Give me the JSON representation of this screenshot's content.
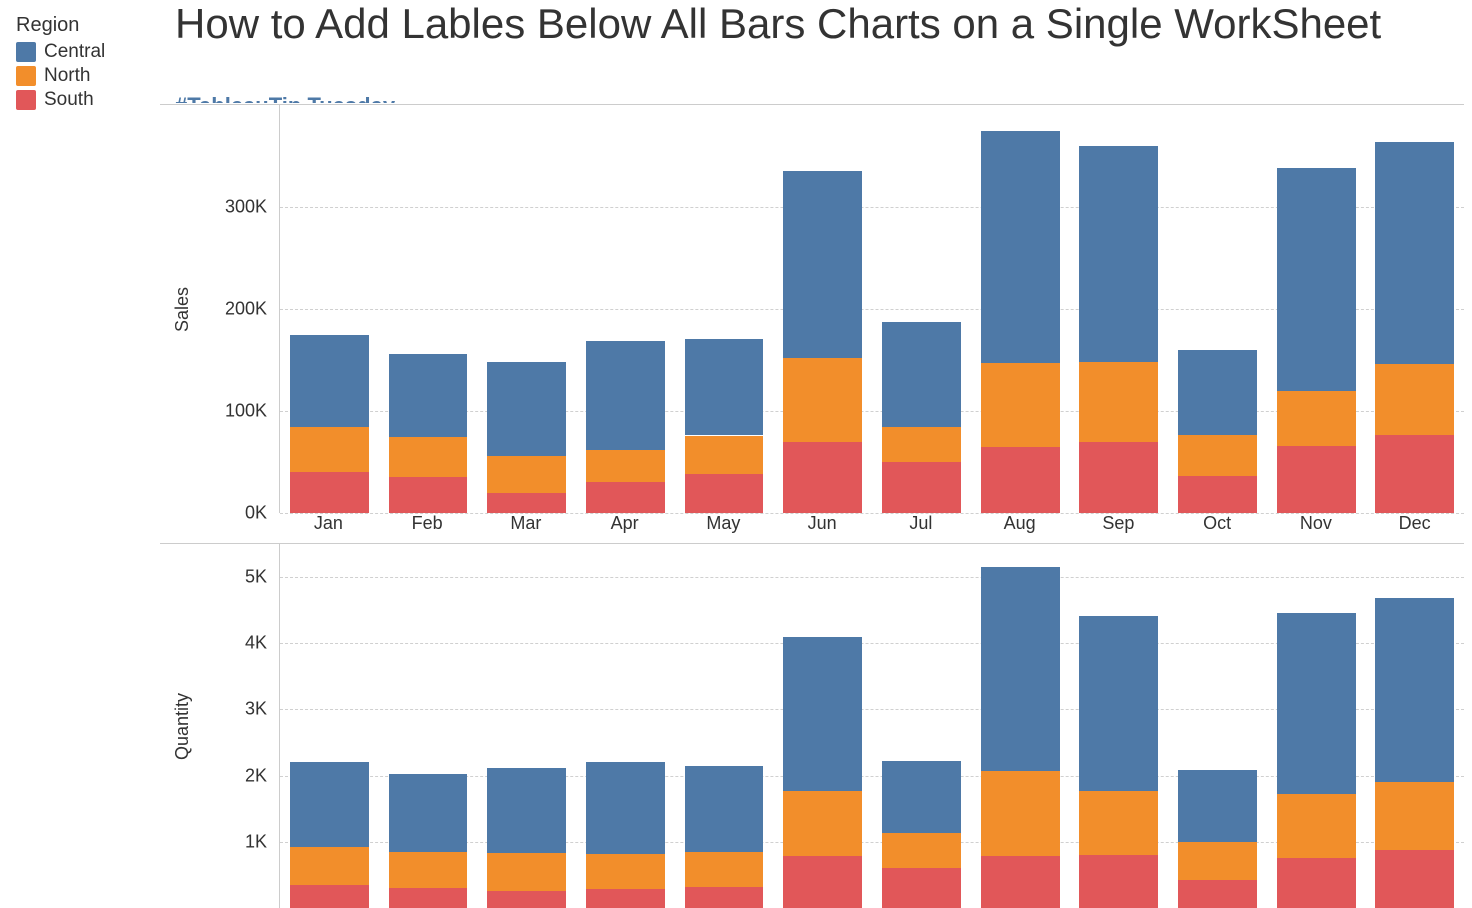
{
  "legend": {
    "title": "Region",
    "items": [
      {
        "label": "Central",
        "color": "#4e79a7"
      },
      {
        "label": "North",
        "color": "#f28e2b"
      },
      {
        "label": "South",
        "color": "#e15759"
      }
    ]
  },
  "title": "How to Add Lables Below All Bars Charts on a Single WorkSheet",
  "hashtag": "#TableauTip Tuesday",
  "chart_data": [
    {
      "type": "bar",
      "stacked": true,
      "ylabel": "Sales",
      "ylim": [
        0,
        400000
      ],
      "yticks": [
        0,
        100000,
        200000,
        300000
      ],
      "ytick_labels": [
        "0K",
        "100K",
        "200K",
        "300K"
      ],
      "categories": [
        "Jan",
        "Feb",
        "Mar",
        "Apr",
        "May",
        "Jun",
        "Jul",
        "Aug",
        "Sep",
        "Oct",
        "Nov",
        "Dec"
      ],
      "series": [
        {
          "name": "South",
          "color": "#e15759",
          "values": [
            40000,
            35000,
            20000,
            30000,
            38000,
            70000,
            50000,
            65000,
            70000,
            36000,
            66000,
            76000
          ]
        },
        {
          "name": "North",
          "color": "#f28e2b",
          "values": [
            44000,
            40000,
            36000,
            32000,
            38000,
            82000,
            34000,
            82000,
            78000,
            40000,
            54000,
            70000
          ]
        },
        {
          "name": "Central",
          "color": "#4e79a7",
          "values": [
            91000,
            81000,
            92000,
            107000,
            95000,
            183000,
            103000,
            228000,
            212000,
            84000,
            218000,
            218000
          ]
        }
      ]
    },
    {
      "type": "bar",
      "stacked": true,
      "ylabel": "Quantity",
      "ylim": [
        0,
        5500
      ],
      "yticks": [
        1000,
        2000,
        3000,
        4000,
        5000
      ],
      "ytick_labels": [
        "1K",
        "2K",
        "3K",
        "4K",
        "5K"
      ],
      "categories": [
        "Jan",
        "Feb",
        "Mar",
        "Apr",
        "May",
        "Jun",
        "Jul",
        "Aug",
        "Sep",
        "Oct",
        "Nov",
        "Dec"
      ],
      "series": [
        {
          "name": "South",
          "color": "#e15759",
          "values": [
            350,
            300,
            260,
            280,
            320,
            780,
            600,
            780,
            800,
            420,
            760,
            880
          ]
        },
        {
          "name": "North",
          "color": "#f28e2b",
          "values": [
            570,
            550,
            570,
            530,
            520,
            990,
            540,
            1290,
            970,
            580,
            960,
            1020
          ]
        },
        {
          "name": "Central",
          "color": "#4e79a7",
          "values": [
            1280,
            1180,
            1290,
            1390,
            1310,
            2320,
            1080,
            3080,
            2640,
            1090,
            2740,
            2790
          ]
        }
      ]
    }
  ]
}
